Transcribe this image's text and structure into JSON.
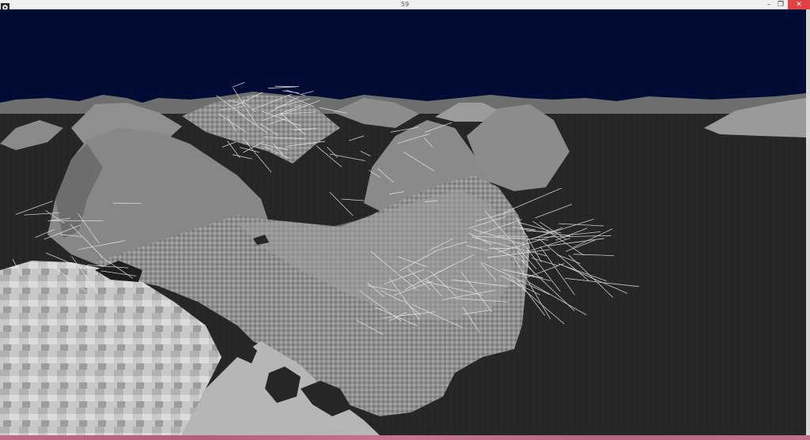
{
  "window": {
    "title": "59",
    "controls": {
      "minimize": "–",
      "maximize": "❐",
      "close": "✕"
    }
  },
  "scene": {
    "sky_color": "#000c33",
    "ground_color": "#262626",
    "terrain_light": "#a9a9a9",
    "terrain_mid": "#8c8c8c",
    "terrain_dark": "#5e5e5e",
    "normal_line_color": "#e8e8e8"
  },
  "taskbar": {
    "color": "#c06a86"
  }
}
